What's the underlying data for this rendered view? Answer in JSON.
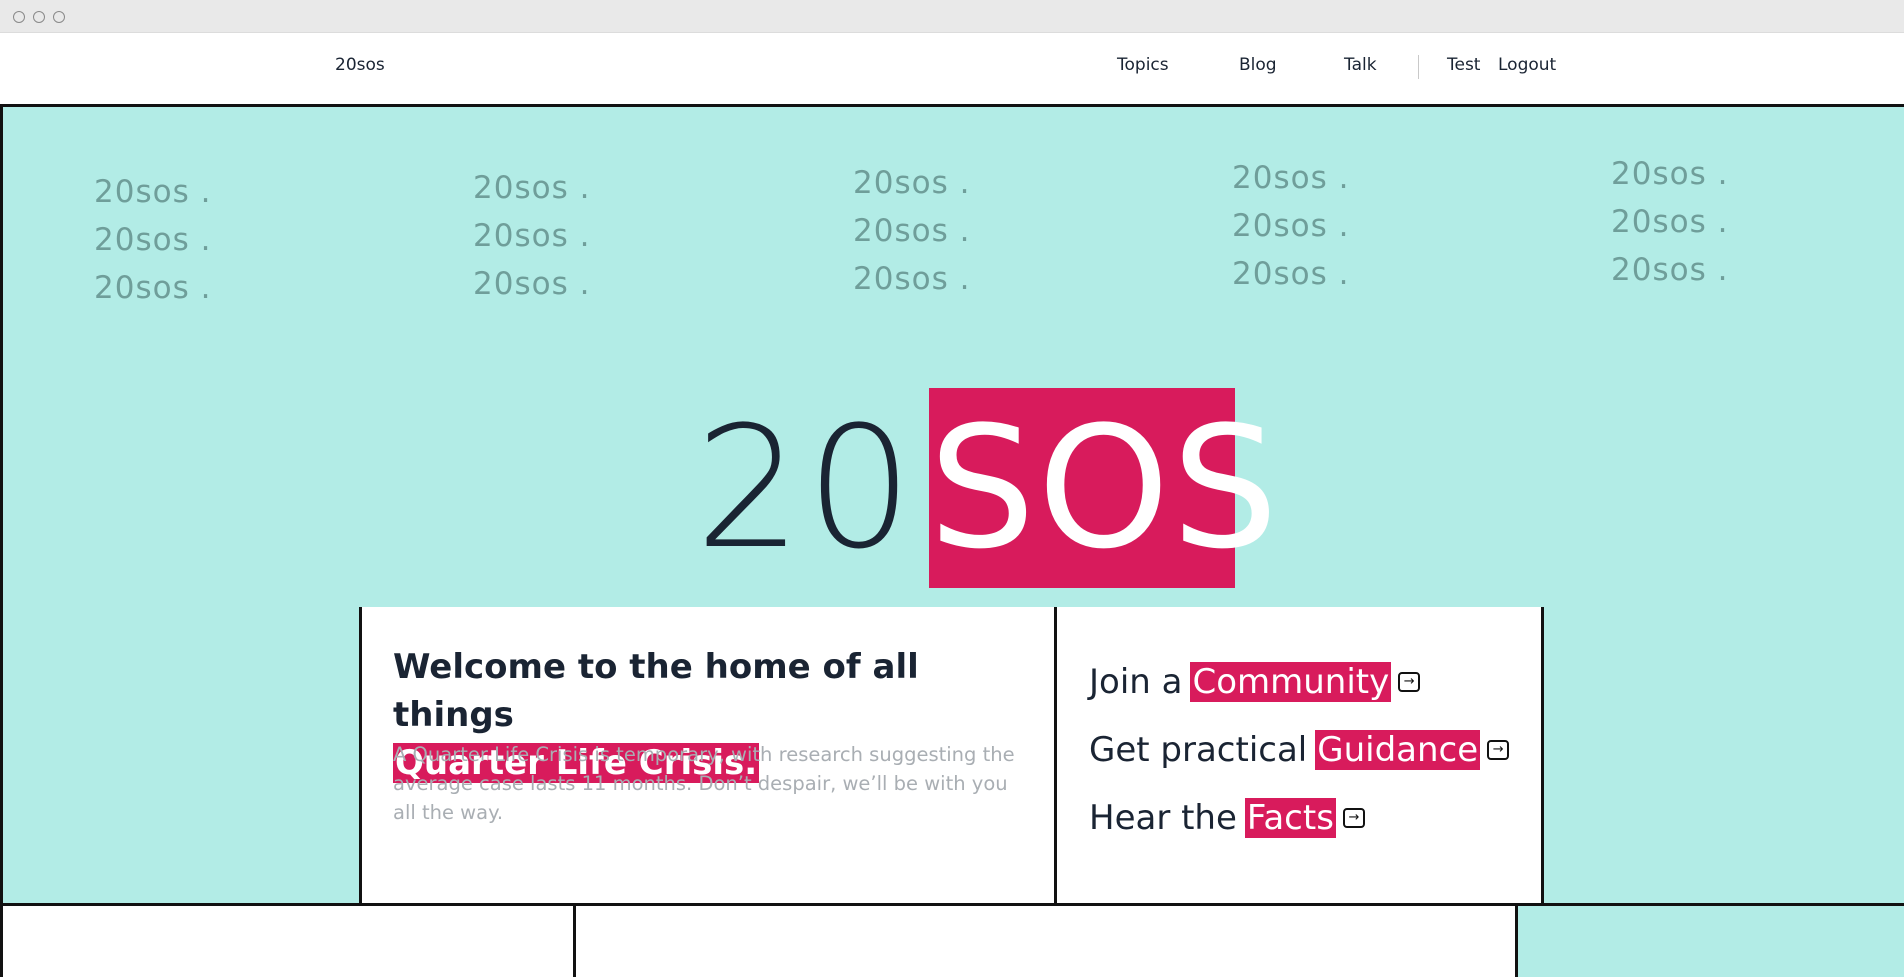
{
  "nav": {
    "brand": "20sos",
    "links": [
      "Topics",
      "Blog",
      "Talk"
    ],
    "user": "Test",
    "logout": "Logout"
  },
  "hero": {
    "repeat_text": "20sos .",
    "logo_number": "20",
    "logo_highlight": "SOS"
  },
  "welcome": {
    "title_prefix": "Welcome to the home of all things",
    "title_highlight": "Quarter Life Crisis.",
    "description": "A Quarter Life Crisis is temporary, with research suggesting the average case lasts 11 months. Don’t despair, we’ll be with you all the way."
  },
  "cta": [
    {
      "lead": "Join a",
      "highlight": "Community",
      "icon": "arrow-right-box-icon"
    },
    {
      "lead": "Get practical",
      "highlight": "Guidance",
      "icon": "arrow-right-box-icon"
    },
    {
      "lead": "Hear the",
      "highlight": "Facts",
      "icon": "arrow-right-box-icon"
    }
  ],
  "colors": {
    "teal": "#b2ece6",
    "accent": "#d81b5c",
    "ink": "#1a2433",
    "muted": "#a9aeb3"
  }
}
